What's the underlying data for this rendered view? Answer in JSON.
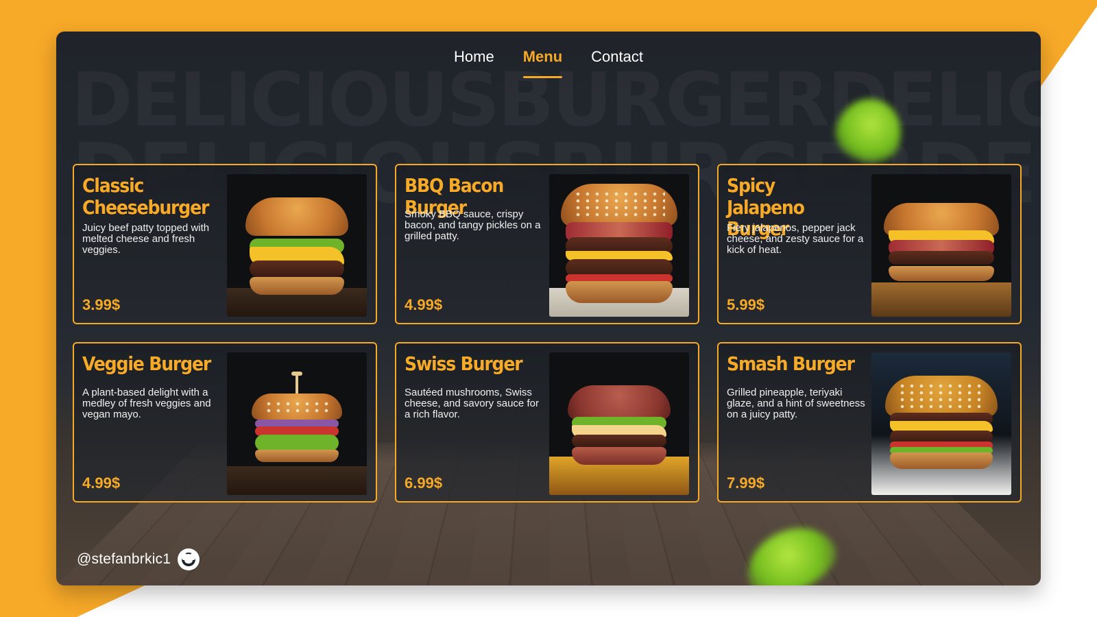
{
  "nav": {
    "items": [
      {
        "label": "Home",
        "active": false
      },
      {
        "label": "Menu",
        "active": true
      },
      {
        "label": "Contact",
        "active": false
      }
    ]
  },
  "background": {
    "line1": "DELICIOUSBURGERDELICIOUSBUR",
    "line2": "DELICIOUSBURGERDELICIOUSBUR"
  },
  "menu": {
    "items": [
      {
        "title": "Classic Cheeseburger",
        "description": "Juicy beef patty topped with melted cheese and fresh veggies.",
        "price": "3.99$",
        "image": "classic-cheeseburger-image"
      },
      {
        "title": "BBQ Bacon Burger",
        "description": "Smoky BBQ sauce, crispy bacon, and tangy pickles on a grilled patty.",
        "price": "4.99$",
        "image": "bbq-bacon-burger-image"
      },
      {
        "title": "Spicy Jalapeno Burger",
        "description": "Fiery jalapenos, pepper jack cheese, and zesty sauce for a kick of heat.",
        "price": "5.99$",
        "image": "spicy-jalapeno-burger-image"
      },
      {
        "title": "Veggie Burger",
        "description": "A plant-based delight with a medley of fresh veggies and vegan mayo.",
        "price": "4.99$",
        "image": "veggie-burger-image"
      },
      {
        "title": "Swiss Burger",
        "description": "Sautéed mushrooms, Swiss cheese, and savory sauce for a rich flavor.",
        "price": "6.99$",
        "image": "swiss-burger-image"
      },
      {
        "title": "Smash Burger",
        "description": "Grilled pineapple, teriyaki glaze, and a hint of sweetness on a juicy patty.",
        "price": "7.99$",
        "image": "smash-burger-image"
      }
    ]
  },
  "footer": {
    "handle": "@stefanbrkic1",
    "icon": "github-icon"
  },
  "colors": {
    "accent": "#f7a928",
    "text": "#ffffff",
    "panel": "#20242a"
  }
}
